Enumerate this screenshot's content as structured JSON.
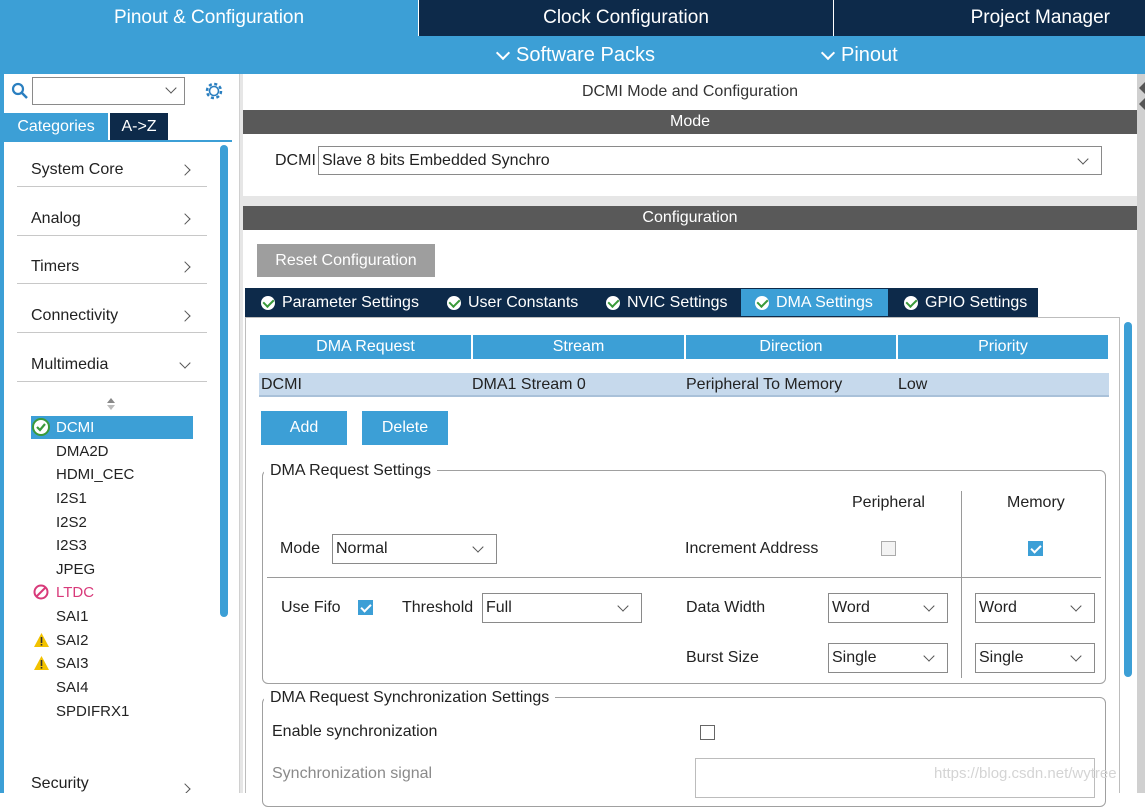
{
  "top_tabs": {
    "pinout": "Pinout & Configuration",
    "clock": "Clock Configuration",
    "project": "Project Manager"
  },
  "sub_menu": {
    "software_packs": "Software Packs",
    "pinout": "Pinout"
  },
  "left": {
    "search_value": "",
    "tabs": {
      "categories": "Categories",
      "az": "A->Z"
    },
    "categories": [
      {
        "label": "System Core"
      },
      {
        "label": "Analog"
      },
      {
        "label": "Timers"
      },
      {
        "label": "Connectivity"
      },
      {
        "label": "Multimedia"
      },
      {
        "label": "Security"
      }
    ],
    "multimedia_items": [
      {
        "label": "DCMI",
        "status": "ok"
      },
      {
        "label": "DMA2D",
        "status": ""
      },
      {
        "label": "HDMI_CEC",
        "status": ""
      },
      {
        "label": "I2S1",
        "status": ""
      },
      {
        "label": "I2S2",
        "status": ""
      },
      {
        "label": "I2S3",
        "status": ""
      },
      {
        "label": "JPEG",
        "status": ""
      },
      {
        "label": "LTDC",
        "status": "disabled"
      },
      {
        "label": "SAI1",
        "status": ""
      },
      {
        "label": "SAI2",
        "status": "warning"
      },
      {
        "label": "SAI3",
        "status": "warning"
      },
      {
        "label": "SAI4",
        "status": ""
      },
      {
        "label": "SPDIFRX1",
        "status": ""
      }
    ]
  },
  "main": {
    "title": "DCMI Mode and Configuration",
    "mode_header": "Mode",
    "mode_label": "DCMI",
    "mode_value": "Slave 8 bits Embedded Synchro",
    "config_header": "Configuration",
    "reset_button": "Reset Configuration",
    "tabs": [
      "Parameter Settings",
      "User Constants",
      "NVIC Settings",
      "DMA Settings",
      "GPIO Settings"
    ],
    "table": {
      "headers": [
        "DMA Request",
        "Stream",
        "Direction",
        "Priority"
      ],
      "rows": [
        [
          "DCMI",
          "DMA1 Stream 0",
          "Peripheral To Memory",
          "Low"
        ]
      ]
    },
    "add_button": "Add",
    "delete_button": "Delete",
    "dma_settings": {
      "legend": "DMA Request Settings",
      "peripheral_header": "Peripheral",
      "memory_header": "Memory",
      "mode_label": "Mode",
      "mode_value": "Normal",
      "increment_label": "Increment Address",
      "increment_peripheral": false,
      "increment_memory": true,
      "fifo_label": "Use Fifo",
      "fifo_checked": true,
      "threshold_label": "Threshold",
      "threshold_value": "Full",
      "data_width_label": "Data Width",
      "data_width_peripheral": "Word",
      "data_width_memory": "Word",
      "burst_label": "Burst Size",
      "burst_peripheral": "Single",
      "burst_memory": "Single"
    },
    "sync_settings": {
      "legend": "DMA Request Synchronization Settings",
      "enable_label": "Enable synchronization",
      "enable_checked": false,
      "signal_label": "Synchronization signal",
      "signal_value": ""
    }
  },
  "watermark": "https://blog.csdn.net/wytree",
  "colors": {
    "accent": "#3c9fd6",
    "navy": "#0d2a4a",
    "header_gray": "#595959",
    "selected_row": "#c6d9ec",
    "warning": "#f2c200",
    "error": "#d83a7a"
  }
}
